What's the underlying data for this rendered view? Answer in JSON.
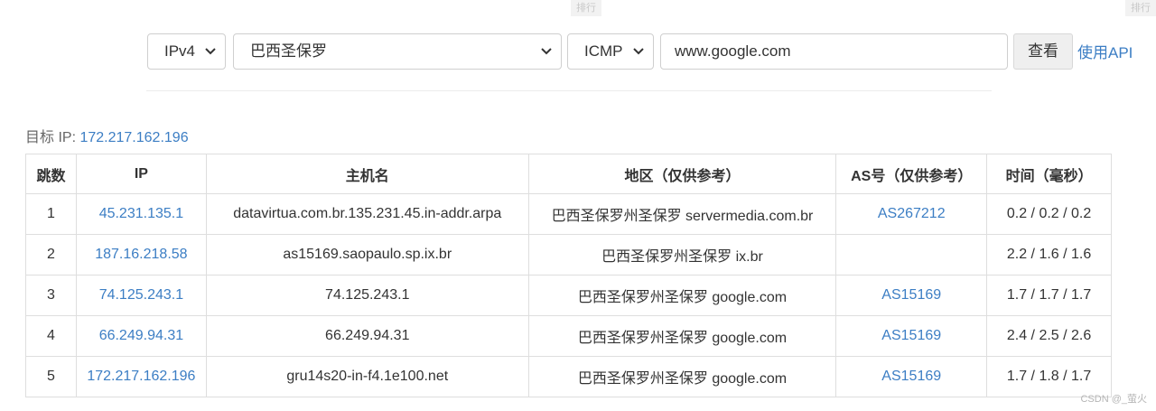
{
  "toolbar": {
    "ip_version": "IPv4",
    "location": "巴西圣保罗",
    "protocol": "ICMP",
    "host_value": "www.google.com",
    "query_label": "查看",
    "api_link": "使用API"
  },
  "result": {
    "target_label": "目标 IP: ",
    "target_ip": "172.217.162.196"
  },
  "table": {
    "headers": [
      "跳数",
      "IP",
      "主机名",
      "地区（仅供参考）",
      "AS号（仅供参考）",
      "时间（毫秒）"
    ],
    "rows": [
      {
        "hop": "1",
        "ip": "45.231.135.1",
        "host": "datavirtua.com.br.135.231.45.in-addr.arpa",
        "region": "巴西圣保罗州圣保罗 servermedia.com.br",
        "asn": "AS267212",
        "time": "0.2 / 0.2 / 0.2"
      },
      {
        "hop": "2",
        "ip": "187.16.218.58",
        "host": "as15169.saopaulo.sp.ix.br",
        "region": "巴西圣保罗州圣保罗 ix.br",
        "asn": "",
        "time": "2.2 / 1.6 / 1.6"
      },
      {
        "hop": "3",
        "ip": "74.125.243.1",
        "host": "74.125.243.1",
        "region": "巴西圣保罗州圣保罗 google.com",
        "asn": "AS15169",
        "time": "1.7 / 1.7 / 1.7"
      },
      {
        "hop": "4",
        "ip": "66.249.94.31",
        "host": "66.249.94.31",
        "region": "巴西圣保罗州圣保罗 google.com",
        "asn": "AS15169",
        "time": "2.4 / 2.5 / 2.6"
      },
      {
        "hop": "5",
        "ip": "172.217.162.196",
        "host": "gru14s20-in-f4.1e100.net",
        "region": "巴西圣保罗州圣保罗 google.com",
        "asn": "AS15169",
        "time": "1.7 / 1.8 / 1.7"
      }
    ]
  },
  "ghost_labels": [
    "排行",
    "排行"
  ],
  "watermark": "CSDN @_萤火",
  "colors": {
    "link": "#3c7ec4",
    "border": "#dedede"
  }
}
